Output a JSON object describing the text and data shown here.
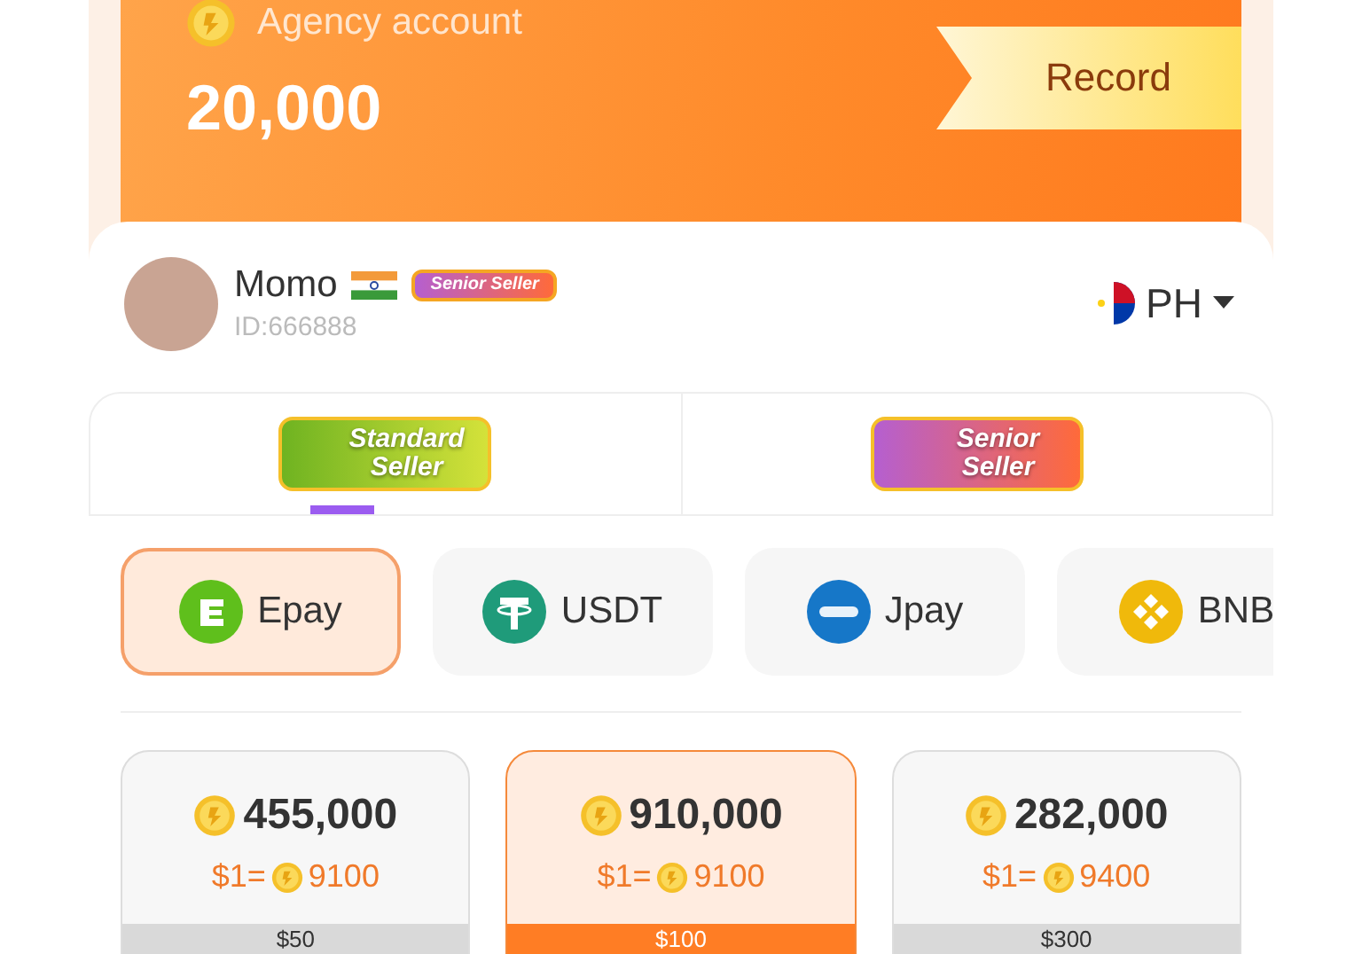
{
  "account": {
    "label": "Agency account",
    "balance": "20,000",
    "record_button": "Record"
  },
  "user": {
    "name": "Momo",
    "badge": "Senior Seller",
    "id": "ID:666888",
    "region": "PH"
  },
  "seller_tabs": [
    {
      "label": "Standard Seller",
      "kind": "standard",
      "selected": true
    },
    {
      "label": "Senior Seller",
      "kind": "senior",
      "selected": false
    }
  ],
  "payment_methods": [
    {
      "label": "Epay",
      "kind": "epay",
      "selected": true
    },
    {
      "label": "USDT",
      "kind": "usdt",
      "selected": false
    },
    {
      "label": "Jpay",
      "kind": "jpay",
      "selected": false
    },
    {
      "label": "BNB",
      "kind": "bnb",
      "selected": false
    }
  ],
  "packages": [
    {
      "coins": "455,000",
      "rate_prefix": "$1=",
      "rate": "9100",
      "price": "$50",
      "selected": false
    },
    {
      "coins": "910,000",
      "rate_prefix": "$1=",
      "rate": "9100",
      "price": "$100",
      "selected": true
    },
    {
      "coins": "282,000",
      "rate_prefix": "$1=",
      "rate": "9400",
      "price": "$300",
      "selected": false
    }
  ]
}
